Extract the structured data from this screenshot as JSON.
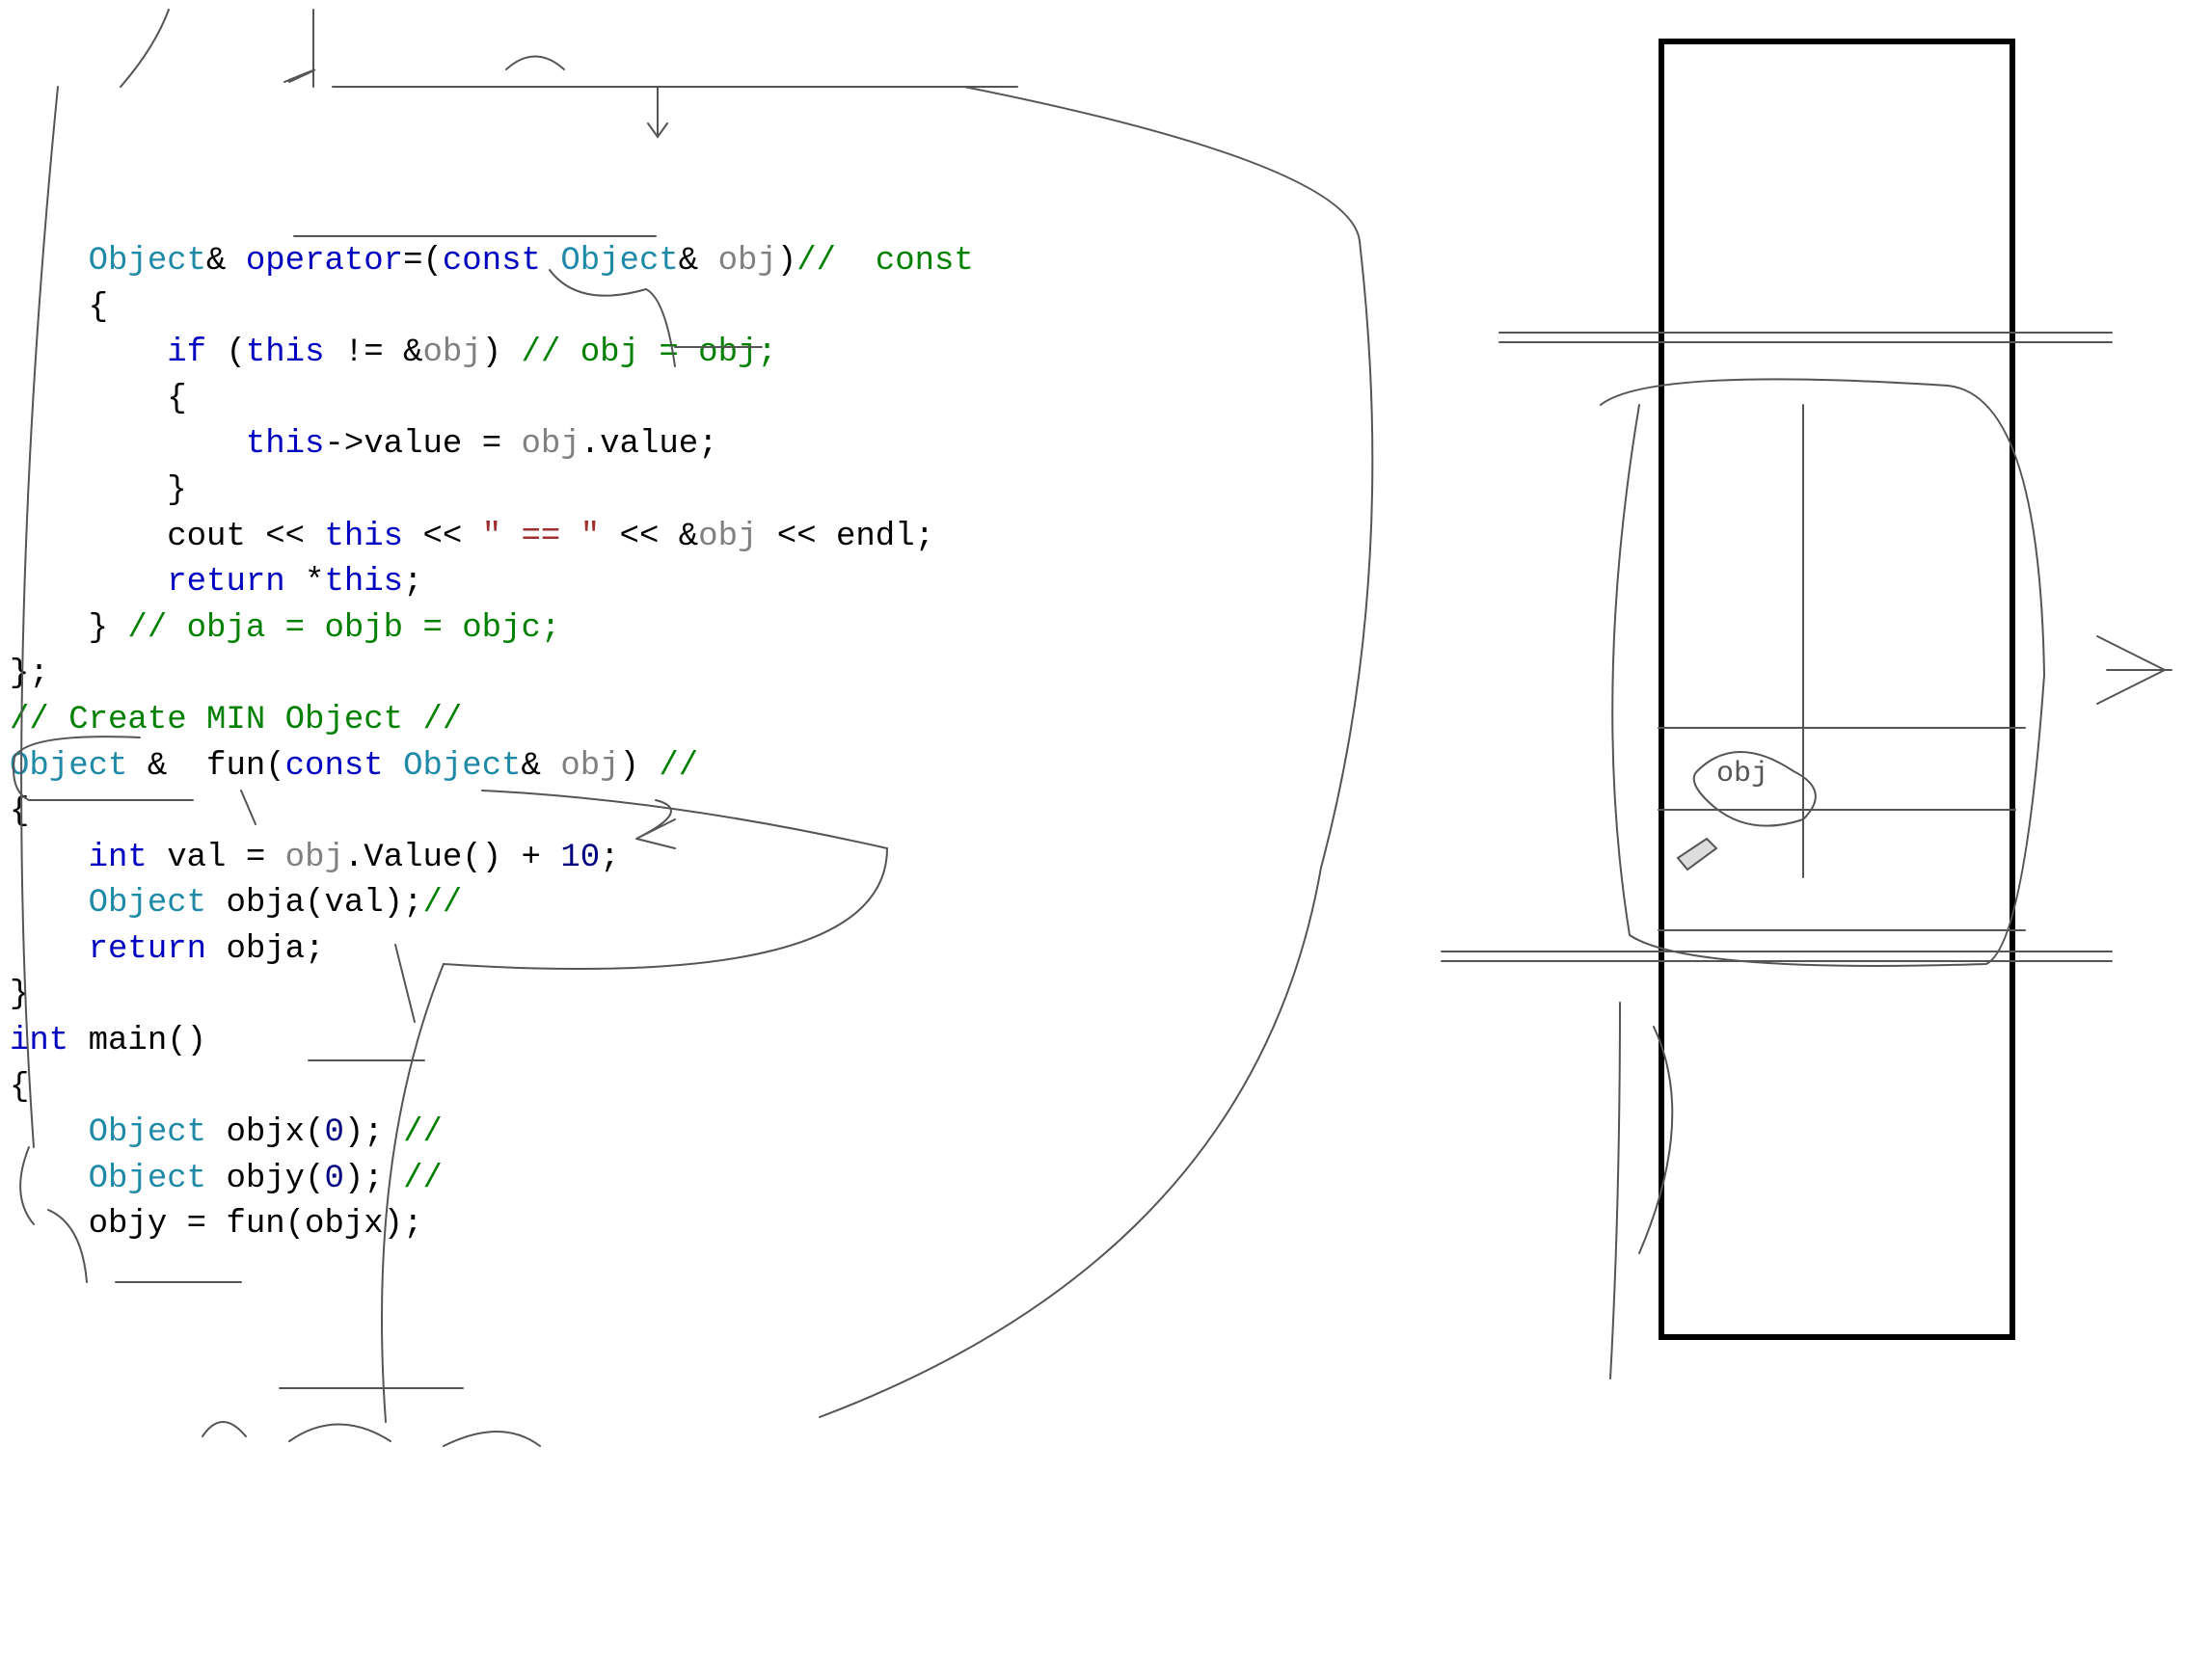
{
  "code": {
    "l1_indent": "    ",
    "l1_a": "Object",
    "l1_b": "& ",
    "l1_c": "operator",
    "l1_d": "=(",
    "l1_e": "const",
    "l1_f": " ",
    "l1_g": "Object",
    "l1_h": "& ",
    "l1_i": "obj",
    "l1_j": ")",
    "l1_k": "//  const ",
    "l2": "    {",
    "l3_indent": "        ",
    "l3_a": "if",
    "l3_b": " (",
    "l3_c": "this",
    "l3_d": " != &",
    "l3_e": "obj",
    "l3_f": ") ",
    "l3_g": "// obj = obj;",
    "l4": "        {",
    "l5_indent": "            ",
    "l5_a": "this",
    "l5_b": "->value = ",
    "l5_c": "obj",
    "l5_d": ".value;",
    "l6": "        }",
    "l7_indent": "        ",
    "l7_a": "cout << ",
    "l7_b": "this",
    "l7_c": " << ",
    "l7_d": "\" == \"",
    "l7_e": " << &",
    "l7_f": "obj",
    "l7_g": " << endl;",
    "l8_indent": "        ",
    "l8_a": "return",
    "l8_b": " *",
    "l8_c": "this",
    "l8_d": ";",
    "l9_a": "    } ",
    "l9_b": "// obja = objb = objc;",
    "l10": "};",
    "l11": "// Create MIN Object //",
    "l12_a": "Object",
    "l12_b": " &  fun(",
    "l12_c": "const",
    "l12_d": " ",
    "l12_e": "Object",
    "l12_f": "& ",
    "l12_g": "obj",
    "l12_h": ") ",
    "l12_i": "// ",
    "l13": "{",
    "l14_indent": "    ",
    "l14_a": "int",
    "l14_b": " val = ",
    "l14_c": "obj",
    "l14_d": ".Value() + ",
    "l14_e": "10",
    "l14_f": ";",
    "l15_indent": "    ",
    "l15_a": "Object",
    "l15_b": " obja(val);",
    "l15_c": "//",
    "l16_indent": "    ",
    "l16_a": "return",
    "l16_b": " obja;",
    "l17": "}",
    "l18_a": "int",
    "l18_b": " main()",
    "l19": "{",
    "l20_indent": "    ",
    "l20_a": "Object",
    "l20_b": " objx(",
    "l20_c": "0",
    "l20_d": "); ",
    "l20_e": "//",
    "l21_indent": "    ",
    "l21_a": "Object",
    "l21_b": " objy(",
    "l21_c": "0",
    "l21_d": "); ",
    "l21_e": "//",
    "l22_indent": "    ",
    "l22_a": "objy = fun(objx);"
  },
  "annotation_text": "obj"
}
